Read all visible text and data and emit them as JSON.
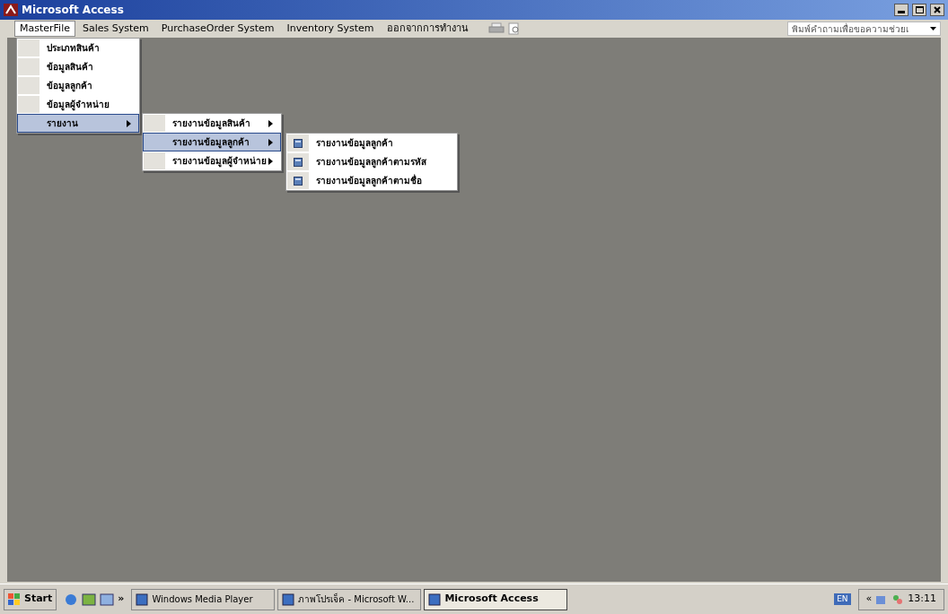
{
  "window": {
    "title": "Microsoft Access"
  },
  "menu_bar": {
    "items": [
      {
        "label": "MasterFile",
        "selected": true
      },
      {
        "label": "Sales System",
        "selected": false
      },
      {
        "label": "PurchaseOrder System",
        "selected": false
      },
      {
        "label": "Inventory System",
        "selected": false
      },
      {
        "label": "ออกจากการทำงาน",
        "selected": false
      }
    ],
    "help_box": {
      "placeholder": "พิมพ์คำถามเพื่อขอความช่วยเ"
    }
  },
  "menu": {
    "items": [
      {
        "label": "ประเภทสินค้า",
        "kind": "command",
        "selected": false
      },
      {
        "label": "ข้อมูลสินค้า",
        "kind": "command",
        "selected": false
      },
      {
        "label": "ข้อมูลลูกค้า",
        "kind": "command",
        "selected": false
      },
      {
        "label": "ข้อมูลผู้จำหน่าย",
        "kind": "command",
        "selected": false
      },
      {
        "label": "รายงาน",
        "kind": "submenu",
        "selected": true,
        "children": [
          {
            "label": "รายงานข้อมูลสินค้า",
            "kind": "submenu",
            "selected": false
          },
          {
            "label": "รายงานข้อมูลลูกค้า",
            "kind": "submenu",
            "selected": true,
            "children": [
              {
                "label": "รายงานข้อมูลลูกค้า",
                "kind": "report",
                "selected": false
              },
              {
                "label": "รายงานข้อมูลลูกค้าตามรหัส",
                "kind": "report",
                "selected": false
              },
              {
                "label": "รายงานข้อมูลลูกค้าตามชื่อ",
                "kind": "report",
                "selected": false
              }
            ]
          },
          {
            "label": "รายงานข้อมูลผู้จำหน่าย",
            "kind": "submenu",
            "selected": false
          }
        ]
      }
    ]
  },
  "taskbar": {
    "start": "Start",
    "more": "»",
    "tasks": [
      {
        "label": "Windows Media Player",
        "selected": false
      },
      {
        "label": "ภาพโปรเจ็ค - Microsoft W...",
        "selected": false
      },
      {
        "label": "Microsoft Access",
        "selected": true
      }
    ],
    "language": "EN",
    "tray_expand": "«",
    "clock": "13:11"
  }
}
